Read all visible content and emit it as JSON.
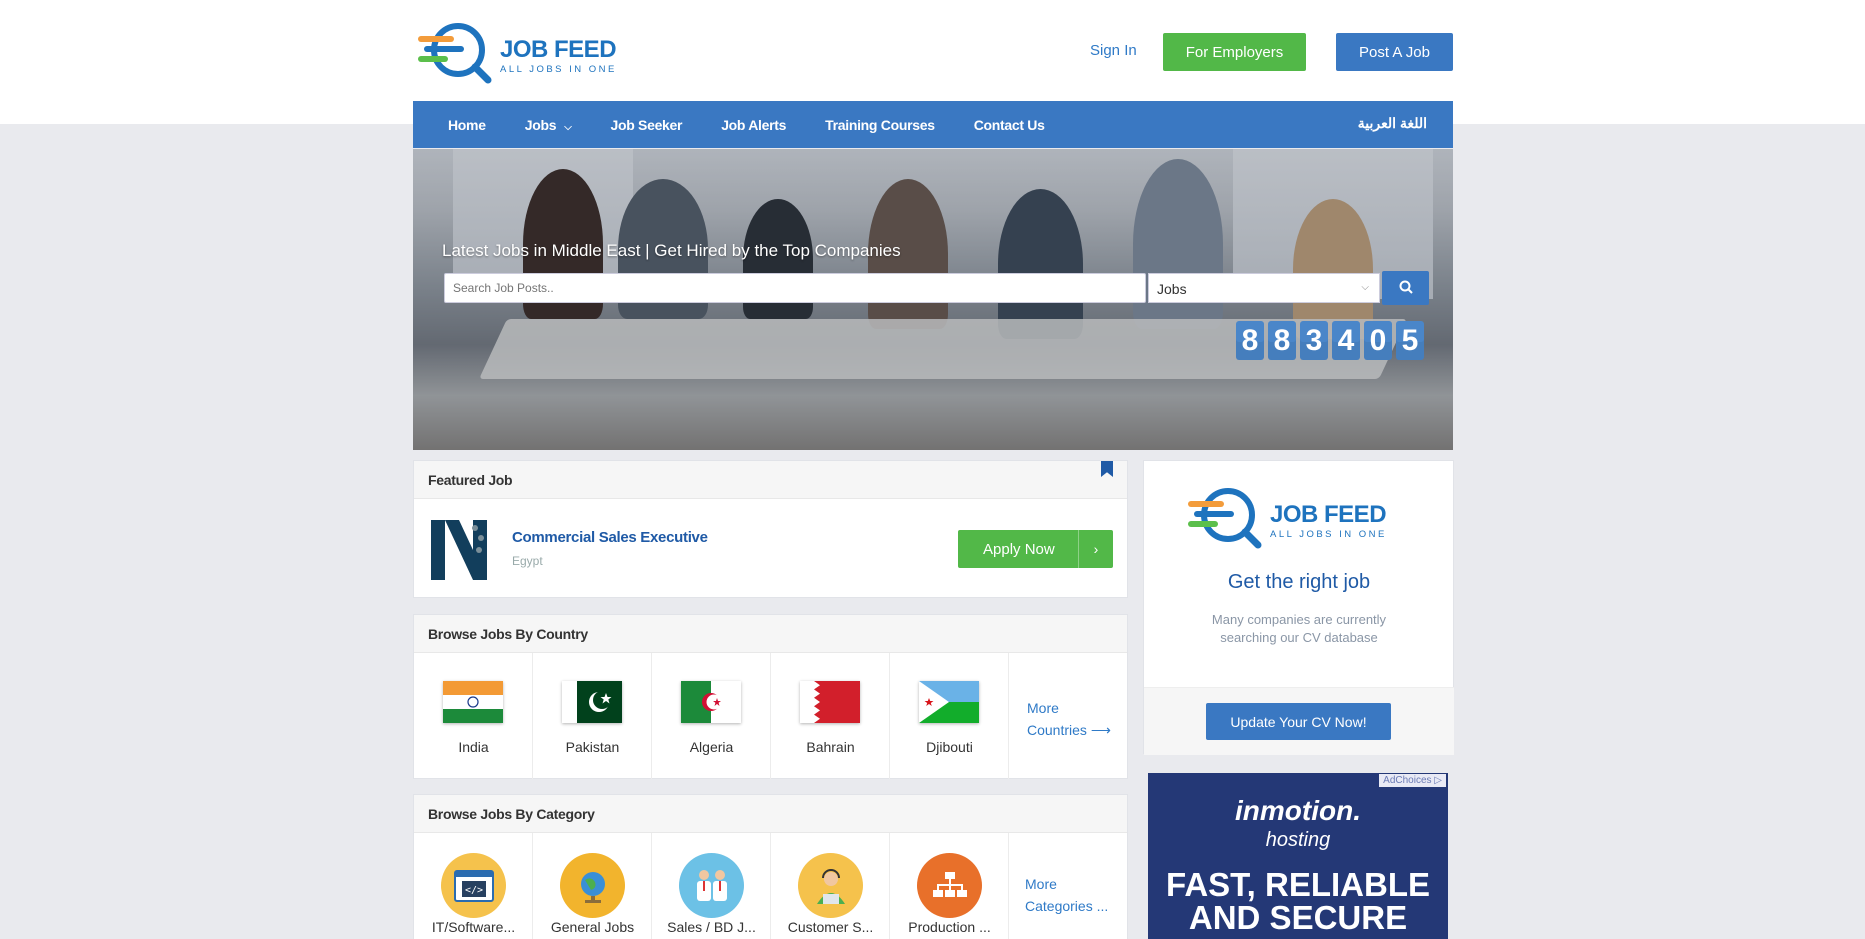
{
  "header": {
    "logo_title": "JOB FEED",
    "logo_sub": "ALL JOBS IN ONE",
    "signin": "Sign In",
    "employers": "For Employers",
    "post_job": "Post A Job"
  },
  "nav": {
    "items": [
      "Home",
      "Jobs",
      "Job Seeker",
      "Job Alerts",
      "Training Courses",
      "Contact Us"
    ],
    "language": "اللغة العربية"
  },
  "hero": {
    "title": "Latest Jobs in Middle East | Get Hired by the Top Companies",
    "search_placeholder": "Search Job Posts..",
    "select_value": "Jobs",
    "counter": [
      "8",
      "8",
      "3",
      "4",
      "0",
      "5"
    ]
  },
  "featured": {
    "heading": "Featured Job",
    "job_title": "Commercial Sales Executive",
    "location": "Egypt",
    "apply": "Apply Now"
  },
  "countries": {
    "heading": "Browse Jobs By Country",
    "items": [
      "India",
      "Pakistan",
      "Algeria",
      "Bahrain",
      "Djibouti"
    ],
    "more_line1": "More",
    "more_line2": "Countries"
  },
  "categories": {
    "heading": "Browse Jobs By Category",
    "items": [
      "IT/Software...",
      "General Jobs",
      "Sales / BD J...",
      "Customer S...",
      "Production ..."
    ],
    "more_line1": "More",
    "more_line2": "Categories ..."
  },
  "sidebar": {
    "logo_title": "JOB FEED",
    "logo_sub": "ALL JOBS IN ONE",
    "title": "Get the right job",
    "text": "Many companies are currently searching our CV database",
    "button": "Update Your CV Now!"
  },
  "ad": {
    "choices": "AdChoices",
    "brand": "inmotion.",
    "sub": "hosting",
    "headline_1": "FAST, RELIABLE",
    "headline_2": "AND SECURE"
  },
  "colors": {
    "primary": "#3a78c2",
    "green": "#52b848",
    "link": "#1f5aa6",
    "background": "#e9eaee"
  }
}
